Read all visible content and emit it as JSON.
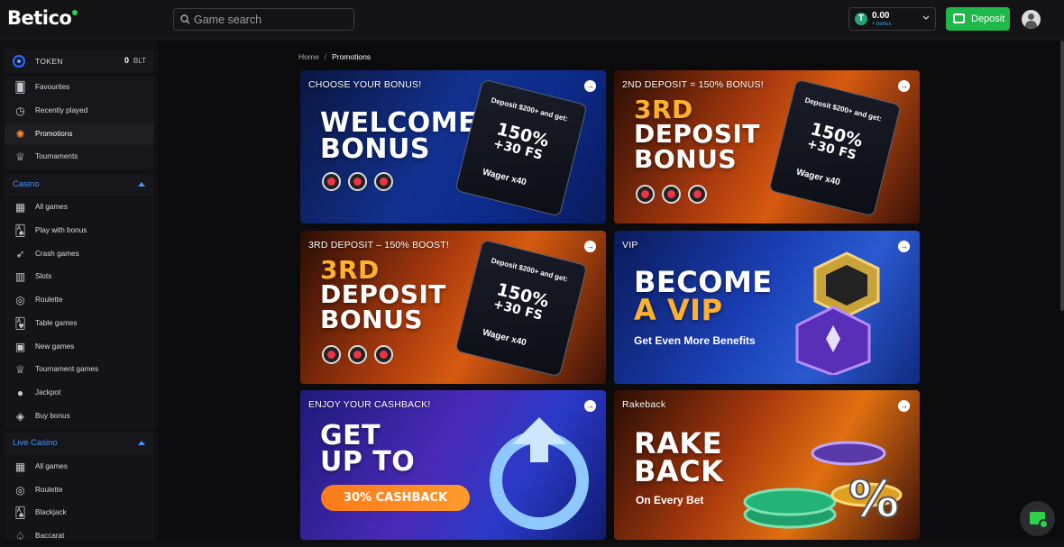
{
  "brand": {
    "name": "Betico"
  },
  "header": {
    "search_placeholder": "Game search",
    "balance_amount": "0.00",
    "balance_sub": "+ bonus",
    "deposit_label": "Deposit"
  },
  "token": {
    "label": "TOKEN",
    "value": "0",
    "currency": "BLT"
  },
  "nav": [
    {
      "label": "Favourites",
      "icon": "cards-icon"
    },
    {
      "label": "Recently played",
      "icon": "clock-icon"
    },
    {
      "label": "Promotions",
      "icon": "gift-icon"
    },
    {
      "label": "Tournaments",
      "icon": "trophy-icon"
    }
  ],
  "casino": {
    "title": "Casino",
    "items": [
      {
        "label": "All games",
        "icon": "grid-icon"
      },
      {
        "label": "Play with bonus",
        "icon": "cards-bonus-icon"
      },
      {
        "label": "Crash games",
        "icon": "rocket-icon"
      },
      {
        "label": "Slots",
        "icon": "slot-icon"
      },
      {
        "label": "Roulette",
        "icon": "roulette-icon"
      },
      {
        "label": "Table games",
        "icon": "cards-icon"
      },
      {
        "label": "New games",
        "icon": "new-icon"
      },
      {
        "label": "Tournament games",
        "icon": "trophy-icon"
      },
      {
        "label": "Jackpot",
        "icon": "bomb-icon"
      },
      {
        "label": "Buy bonus",
        "icon": "buy-icon"
      }
    ]
  },
  "live_casino": {
    "title": "Live Casino",
    "items": [
      {
        "label": "All games",
        "icon": "grid-icon"
      },
      {
        "label": "Roulette",
        "icon": "roulette-icon"
      },
      {
        "label": "Blackjack",
        "icon": "cards-icon"
      },
      {
        "label": "Baccarat",
        "icon": "baccarat-icon"
      }
    ]
  },
  "breadcrumb": {
    "home": "Home",
    "separator": "/",
    "current": "Promotions"
  },
  "promotions": [
    {
      "title": "CHOOSE YOUR BONUS!",
      "line1": "WELCOME",
      "line2": "BONUS",
      "offer_top": "Deposit $200+ and get:",
      "offer_pct": "150%",
      "offer_fs": "+30 FS",
      "offer_wager": "Wager x40"
    },
    {
      "title": "2ND DEPOSIT = 150% BONUS!",
      "line1": "3RD",
      "line2": "DEPOSIT",
      "line3": "BONUS",
      "offer_top": "Deposit $200+ and get:",
      "offer_pct": "150%",
      "offer_fs": "+30 FS",
      "offer_wager": "Wager x40"
    },
    {
      "title": "3RD DEPOSIT – 150% BOOST!",
      "line1": "3RD",
      "line2": "DEPOSIT",
      "line3": "BONUS",
      "offer_top": "Deposit $200+ and get:",
      "offer_pct": "150%",
      "offer_fs": "+30 FS",
      "offer_wager": "Wager x40"
    },
    {
      "title": "VIP",
      "line1": "BECOME",
      "line2": "A VIP",
      "sub": "Get Even More Benefits"
    },
    {
      "title": "ENJOY YOUR CASHBACK!",
      "line1": "GET",
      "line2": "UP TO",
      "pill": "30% CASHBACK"
    },
    {
      "title": "Rakeback",
      "line1": "RAKE",
      "line2": "BACK",
      "sub": "On Every Bet"
    }
  ],
  "colors": {
    "accent_green": "#1fb84a",
    "accent_blue": "#4a90ff"
  }
}
